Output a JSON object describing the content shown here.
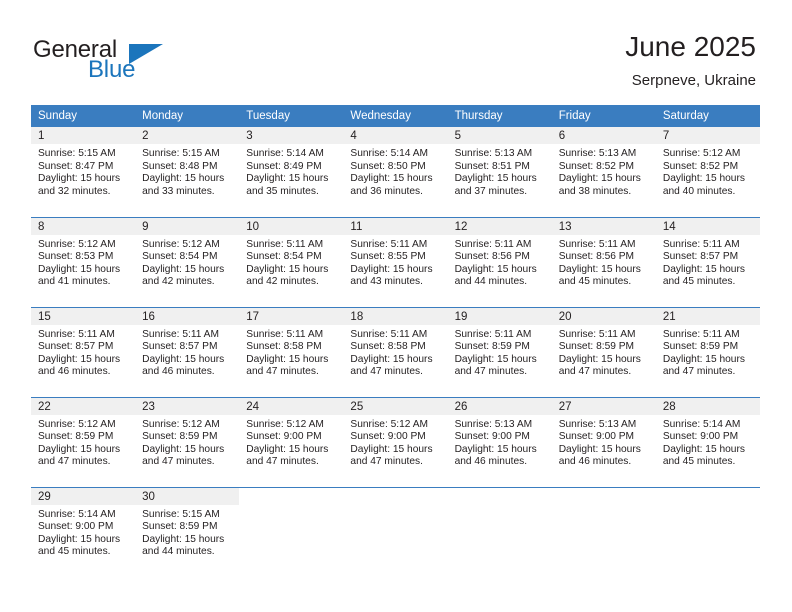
{
  "logo": {
    "word1": "General",
    "word2": "Blue",
    "triangle_color": "#1b75bc",
    "text_color": "#231f20"
  },
  "header": {
    "title": "June 2025",
    "subtitle": "Serpneve, Ukraine"
  },
  "theme": {
    "header_bg": "#3a7dc0",
    "daynum_bg": "#f0f0f0",
    "grid_line": "#3a7dc0"
  },
  "calendar": {
    "weekday_headers": [
      "Sunday",
      "Monday",
      "Tuesday",
      "Wednesday",
      "Thursday",
      "Friday",
      "Saturday"
    ],
    "weeks": [
      [
        {
          "day": "1",
          "sunrise": "Sunrise: 5:15 AM",
          "sunset": "Sunset: 8:47 PM",
          "daylight1": "Daylight: 15 hours",
          "daylight2": "and 32 minutes."
        },
        {
          "day": "2",
          "sunrise": "Sunrise: 5:15 AM",
          "sunset": "Sunset: 8:48 PM",
          "daylight1": "Daylight: 15 hours",
          "daylight2": "and 33 minutes."
        },
        {
          "day": "3",
          "sunrise": "Sunrise: 5:14 AM",
          "sunset": "Sunset: 8:49 PM",
          "daylight1": "Daylight: 15 hours",
          "daylight2": "and 35 minutes."
        },
        {
          "day": "4",
          "sunrise": "Sunrise: 5:14 AM",
          "sunset": "Sunset: 8:50 PM",
          "daylight1": "Daylight: 15 hours",
          "daylight2": "and 36 minutes."
        },
        {
          "day": "5",
          "sunrise": "Sunrise: 5:13 AM",
          "sunset": "Sunset: 8:51 PM",
          "daylight1": "Daylight: 15 hours",
          "daylight2": "and 37 minutes."
        },
        {
          "day": "6",
          "sunrise": "Sunrise: 5:13 AM",
          "sunset": "Sunset: 8:52 PM",
          "daylight1": "Daylight: 15 hours",
          "daylight2": "and 38 minutes."
        },
        {
          "day": "7",
          "sunrise": "Sunrise: 5:12 AM",
          "sunset": "Sunset: 8:52 PM",
          "daylight1": "Daylight: 15 hours",
          "daylight2": "and 40 minutes."
        }
      ],
      [
        {
          "day": "8",
          "sunrise": "Sunrise: 5:12 AM",
          "sunset": "Sunset: 8:53 PM",
          "daylight1": "Daylight: 15 hours",
          "daylight2": "and 41 minutes."
        },
        {
          "day": "9",
          "sunrise": "Sunrise: 5:12 AM",
          "sunset": "Sunset: 8:54 PM",
          "daylight1": "Daylight: 15 hours",
          "daylight2": "and 42 minutes."
        },
        {
          "day": "10",
          "sunrise": "Sunrise: 5:11 AM",
          "sunset": "Sunset: 8:54 PM",
          "daylight1": "Daylight: 15 hours",
          "daylight2": "and 42 minutes."
        },
        {
          "day": "11",
          "sunrise": "Sunrise: 5:11 AM",
          "sunset": "Sunset: 8:55 PM",
          "daylight1": "Daylight: 15 hours",
          "daylight2": "and 43 minutes."
        },
        {
          "day": "12",
          "sunrise": "Sunrise: 5:11 AM",
          "sunset": "Sunset: 8:56 PM",
          "daylight1": "Daylight: 15 hours",
          "daylight2": "and 44 minutes."
        },
        {
          "day": "13",
          "sunrise": "Sunrise: 5:11 AM",
          "sunset": "Sunset: 8:56 PM",
          "daylight1": "Daylight: 15 hours",
          "daylight2": "and 45 minutes."
        },
        {
          "day": "14",
          "sunrise": "Sunrise: 5:11 AM",
          "sunset": "Sunset: 8:57 PM",
          "daylight1": "Daylight: 15 hours",
          "daylight2": "and 45 minutes."
        }
      ],
      [
        {
          "day": "15",
          "sunrise": "Sunrise: 5:11 AM",
          "sunset": "Sunset: 8:57 PM",
          "daylight1": "Daylight: 15 hours",
          "daylight2": "and 46 minutes."
        },
        {
          "day": "16",
          "sunrise": "Sunrise: 5:11 AM",
          "sunset": "Sunset: 8:57 PM",
          "daylight1": "Daylight: 15 hours",
          "daylight2": "and 46 minutes."
        },
        {
          "day": "17",
          "sunrise": "Sunrise: 5:11 AM",
          "sunset": "Sunset: 8:58 PM",
          "daylight1": "Daylight: 15 hours",
          "daylight2": "and 47 minutes."
        },
        {
          "day": "18",
          "sunrise": "Sunrise: 5:11 AM",
          "sunset": "Sunset: 8:58 PM",
          "daylight1": "Daylight: 15 hours",
          "daylight2": "and 47 minutes."
        },
        {
          "day": "19",
          "sunrise": "Sunrise: 5:11 AM",
          "sunset": "Sunset: 8:59 PM",
          "daylight1": "Daylight: 15 hours",
          "daylight2": "and 47 minutes."
        },
        {
          "day": "20",
          "sunrise": "Sunrise: 5:11 AM",
          "sunset": "Sunset: 8:59 PM",
          "daylight1": "Daylight: 15 hours",
          "daylight2": "and 47 minutes."
        },
        {
          "day": "21",
          "sunrise": "Sunrise: 5:11 AM",
          "sunset": "Sunset: 8:59 PM",
          "daylight1": "Daylight: 15 hours",
          "daylight2": "and 47 minutes."
        }
      ],
      [
        {
          "day": "22",
          "sunrise": "Sunrise: 5:12 AM",
          "sunset": "Sunset: 8:59 PM",
          "daylight1": "Daylight: 15 hours",
          "daylight2": "and 47 minutes."
        },
        {
          "day": "23",
          "sunrise": "Sunrise: 5:12 AM",
          "sunset": "Sunset: 8:59 PM",
          "daylight1": "Daylight: 15 hours",
          "daylight2": "and 47 minutes."
        },
        {
          "day": "24",
          "sunrise": "Sunrise: 5:12 AM",
          "sunset": "Sunset: 9:00 PM",
          "daylight1": "Daylight: 15 hours",
          "daylight2": "and 47 minutes."
        },
        {
          "day": "25",
          "sunrise": "Sunrise: 5:12 AM",
          "sunset": "Sunset: 9:00 PM",
          "daylight1": "Daylight: 15 hours",
          "daylight2": "and 47 minutes."
        },
        {
          "day": "26",
          "sunrise": "Sunrise: 5:13 AM",
          "sunset": "Sunset: 9:00 PM",
          "daylight1": "Daylight: 15 hours",
          "daylight2": "and 46 minutes."
        },
        {
          "day": "27",
          "sunrise": "Sunrise: 5:13 AM",
          "sunset": "Sunset: 9:00 PM",
          "daylight1": "Daylight: 15 hours",
          "daylight2": "and 46 minutes."
        },
        {
          "day": "28",
          "sunrise": "Sunrise: 5:14 AM",
          "sunset": "Sunset: 9:00 PM",
          "daylight1": "Daylight: 15 hours",
          "daylight2": "and 45 minutes."
        }
      ],
      [
        {
          "day": "29",
          "sunrise": "Sunrise: 5:14 AM",
          "sunset": "Sunset: 9:00 PM",
          "daylight1": "Daylight: 15 hours",
          "daylight2": "and 45 minutes."
        },
        {
          "day": "30",
          "sunrise": "Sunrise: 5:15 AM",
          "sunset": "Sunset: 8:59 PM",
          "daylight1": "Daylight: 15 hours",
          "daylight2": "and 44 minutes."
        },
        {
          "day": "",
          "sunrise": "",
          "sunset": "",
          "daylight1": "",
          "daylight2": ""
        },
        {
          "day": "",
          "sunrise": "",
          "sunset": "",
          "daylight1": "",
          "daylight2": ""
        },
        {
          "day": "",
          "sunrise": "",
          "sunset": "",
          "daylight1": "",
          "daylight2": ""
        },
        {
          "day": "",
          "sunrise": "",
          "sunset": "",
          "daylight1": "",
          "daylight2": ""
        },
        {
          "day": "",
          "sunrise": "",
          "sunset": "",
          "daylight1": "",
          "daylight2": ""
        }
      ]
    ]
  }
}
